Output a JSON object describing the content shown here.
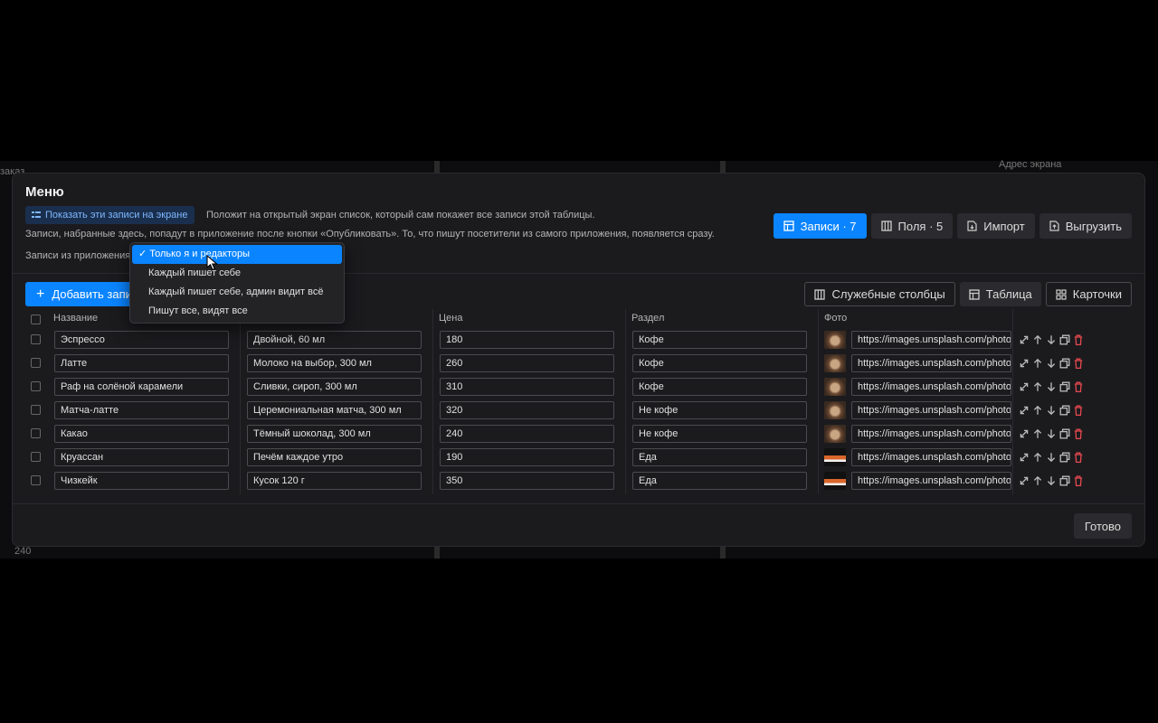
{
  "background": {
    "left_labels": [
      "заказ",
      "240"
    ],
    "right_labels": [
      "Адрес экрана"
    ]
  },
  "dialog": {
    "title": "Меню",
    "show_button": "Показать эти записи на экране",
    "show_description": "Положит на открытый экран список, который сам покажет все записи этой таблицы.",
    "info": "Записи, набранные здесь, попадут в приложение после кнопки «Опубликовать». То, что пишут посетители из самого приложения, появляется сразу.",
    "permissions_label": "Записи из приложения",
    "permissions_options": [
      {
        "label": "Только я и редакторы",
        "selected": true
      },
      {
        "label": "Каждый пишет себе",
        "selected": false
      },
      {
        "label": "Каждый пишет себе, админ видит всё",
        "selected": false
      },
      {
        "label": "Пишут все, видят все",
        "selected": false
      }
    ],
    "tabs": [
      {
        "label": "Записи · 7",
        "icon": "table-icon",
        "active": true
      },
      {
        "label": "Поля · 5",
        "icon": "columns-icon",
        "active": false
      },
      {
        "label": "Импорт",
        "icon": "file-import-icon",
        "active": false
      },
      {
        "label": "Выгрузить",
        "icon": "file-export-icon",
        "active": false
      }
    ],
    "add_button": "Добавить записи",
    "view_buttons": [
      {
        "label": "Служебные столбцы",
        "icon": "columns-icon"
      },
      {
        "label": "Таблица",
        "icon": "table-icon"
      },
      {
        "label": "Карточки",
        "icon": "grid-icon"
      }
    ],
    "columns": [
      "Название",
      "",
      "Цена",
      "Раздел",
      "Фото"
    ],
    "rows": [
      {
        "name": "Эспрессо",
        "desc": "Двойной, 60 мл",
        "price": "180",
        "section": "Кофе",
        "photo": "https://images.unsplash.com/photo",
        "thumb": "coffee"
      },
      {
        "name": "Латте",
        "desc": "Молоко на выбор, 300 мл",
        "price": "260",
        "section": "Кофе",
        "photo": "https://images.unsplash.com/photo",
        "thumb": "coffee"
      },
      {
        "name": "Раф на солёной карамели",
        "desc": "Сливки, сироп, 300 мл",
        "price": "310",
        "section": "Кофе",
        "photo": "https://images.unsplash.com/photo",
        "thumb": "coffee"
      },
      {
        "name": "Матча-латте",
        "desc": "Церемониальная матча, 300 мл",
        "price": "320",
        "section": "Не кофе",
        "photo": "https://images.unsplash.com/photo",
        "thumb": "coffee"
      },
      {
        "name": "Какао",
        "desc": "Тёмный шоколад, 300 мл",
        "price": "240",
        "section": "Не кофе",
        "photo": "https://images.unsplash.com/photo",
        "thumb": "coffee"
      },
      {
        "name": "Круассан",
        "desc": "Печём каждое утро",
        "price": "190",
        "section": "Еда",
        "photo": "https://images.unsplash.com/photo",
        "thumb": "food"
      },
      {
        "name": "Чизкейк",
        "desc": "Кусок 120 г",
        "price": "350",
        "section": "Еда",
        "photo": "https://images.unsplash.com/photo",
        "thumb": "food"
      }
    ],
    "done_button": "Готово"
  },
  "colors": {
    "accent": "#0a84ff",
    "danger": "#e5484d",
    "panel": "#1b1b1e"
  }
}
